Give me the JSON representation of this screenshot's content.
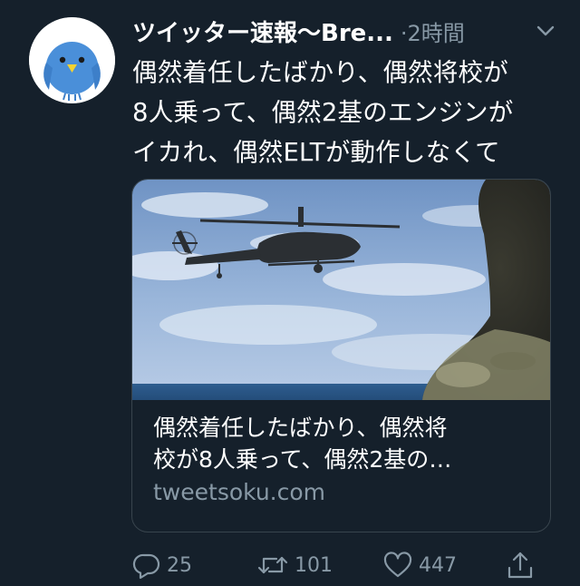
{
  "tweet": {
    "author": "ツイッター速報〜Bre...",
    "time": "·2時間",
    "text_lines": [
      "偶然着任したばかり、偶然将校が",
      "8人乗って、偶然2基のエンジンが",
      "イカれ、偶然ELTが動作しなくて"
    ]
  },
  "card": {
    "title_lines": [
      "偶然着任したばかり、偶然将",
      "校が8人乗って、偶然2基の…"
    ],
    "domain": "tweetsoku.com"
  },
  "actions": {
    "reply_count": "25",
    "retweet_count": "101",
    "like_count": "447"
  },
  "icons": {
    "avatar": "blue-bird-icon",
    "menu": "chevron-down-icon",
    "reply": "reply-bubble-icon",
    "retweet": "retweet-icon",
    "like": "heart-icon",
    "share": "share-icon"
  },
  "colors": {
    "background": "#15202b",
    "text": "#ffffff",
    "secondary": "#8899a6",
    "border": "#38444d",
    "avatar_bird": "#4a8fd9"
  }
}
